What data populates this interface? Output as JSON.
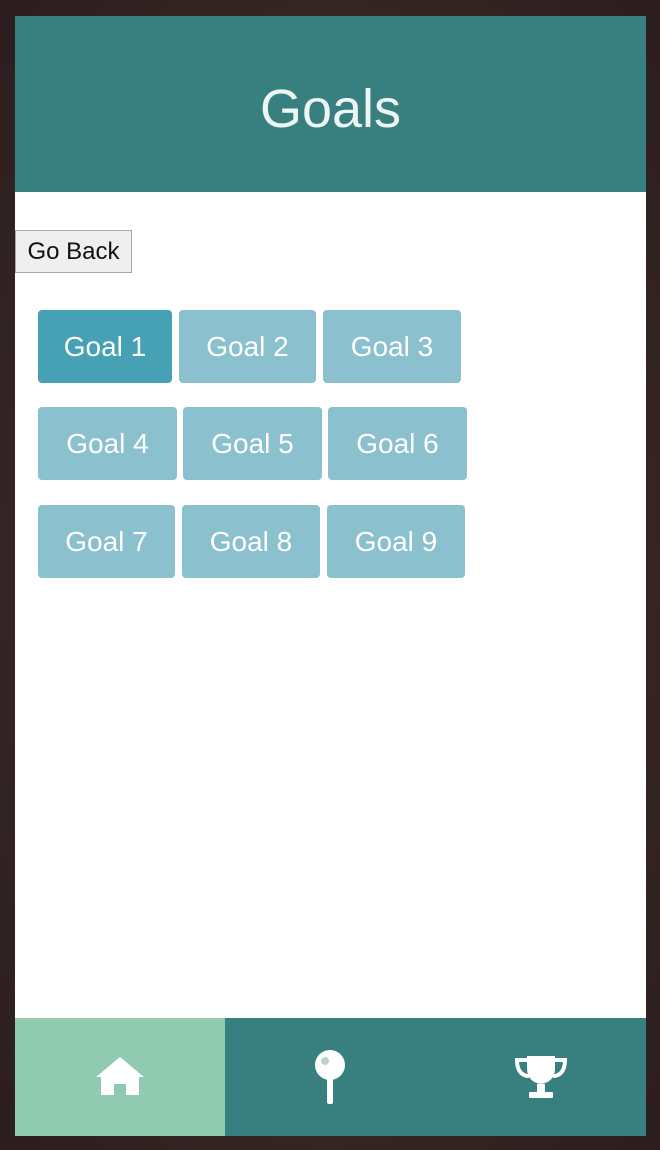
{
  "header": {
    "title": "Goals"
  },
  "back_button": {
    "label": "Go Back"
  },
  "goals": [
    {
      "label": "Goal 1",
      "state": "active"
    },
    {
      "label": "Goal 2",
      "state": "inactive"
    },
    {
      "label": "Goal 3",
      "state": "inactive"
    },
    {
      "label": "Goal 4",
      "state": "inactive"
    },
    {
      "label": "Goal 5",
      "state": "inactive"
    },
    {
      "label": "Goal 6",
      "state": "inactive"
    },
    {
      "label": "Goal 7",
      "state": "inactive"
    },
    {
      "label": "Goal 8",
      "state": "inactive"
    },
    {
      "label": "Goal 9",
      "state": "inactive"
    }
  ],
  "bottom_nav": {
    "items": [
      {
        "icon": "home-icon",
        "active": true
      },
      {
        "icon": "pin-icon",
        "active": false
      },
      {
        "icon": "trophy-icon",
        "active": false
      }
    ]
  },
  "colors": {
    "header_bg": "#387f80",
    "goal_active": "#46a1b5",
    "goal_inactive": "#8bc1ce",
    "nav_active": "#8fcab1",
    "nav_bg": "#387f80"
  }
}
